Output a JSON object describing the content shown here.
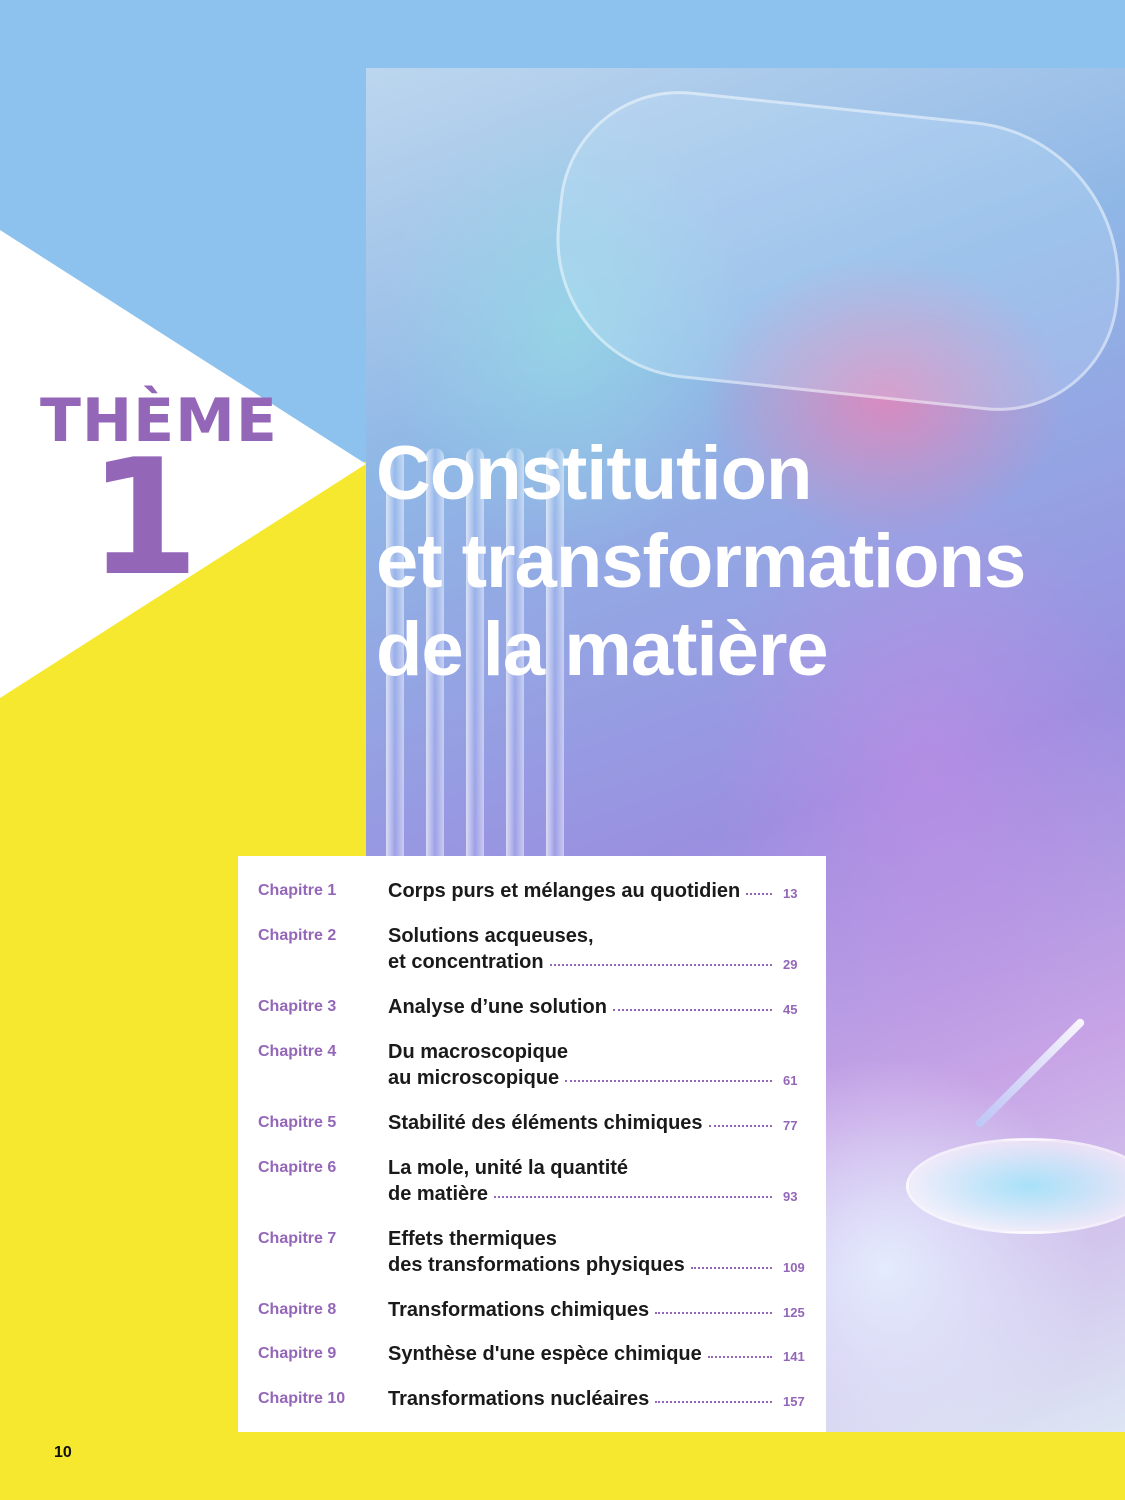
{
  "theme": {
    "label": "THÈME",
    "number": "1"
  },
  "title_lines": [
    "Constitution",
    "et transformations",
    "de la matière"
  ],
  "toc": [
    {
      "chapter": "Chapitre 1",
      "lines": [
        "Corps purs et mélanges au quotidien"
      ],
      "page": "13"
    },
    {
      "chapter": "Chapitre 2",
      "lines": [
        "Solutions acqueuses,",
        "et concentration"
      ],
      "page": "29"
    },
    {
      "chapter": "Chapitre 3",
      "lines": [
        "Analyse d’une solution"
      ],
      "page": "45"
    },
    {
      "chapter": "Chapitre 4",
      "lines": [
        "Du macroscopique",
        "au microscopique"
      ],
      "page": "61"
    },
    {
      "chapter": "Chapitre 5",
      "lines": [
        "Stabilité des éléments chimiques"
      ],
      "page": "77"
    },
    {
      "chapter": "Chapitre 6",
      "lines": [
        "La mole, unité la quantité",
        "de matière"
      ],
      "page": "93"
    },
    {
      "chapter": "Chapitre 7",
      "lines": [
        "Effets thermiques",
        "des transformations physiques"
      ],
      "page": "109"
    },
    {
      "chapter": "Chapitre 8",
      "lines": [
        "Transformations chimiques"
      ],
      "page": "125"
    },
    {
      "chapter": "Chapitre 9",
      "lines": [
        "Synthèse d'une espèce chimique"
      ],
      "page": "141"
    },
    {
      "chapter": "Chapitre 10",
      "lines": [
        "Transformations nucléaires"
      ],
      "page": "157"
    }
  ],
  "page_number": "10",
  "colors": {
    "accent": "#9466b8",
    "yellow": "#f5e82e",
    "blue": "#8dc2ef"
  },
  "photo": {
    "icon": "scientist-lab-photo"
  }
}
